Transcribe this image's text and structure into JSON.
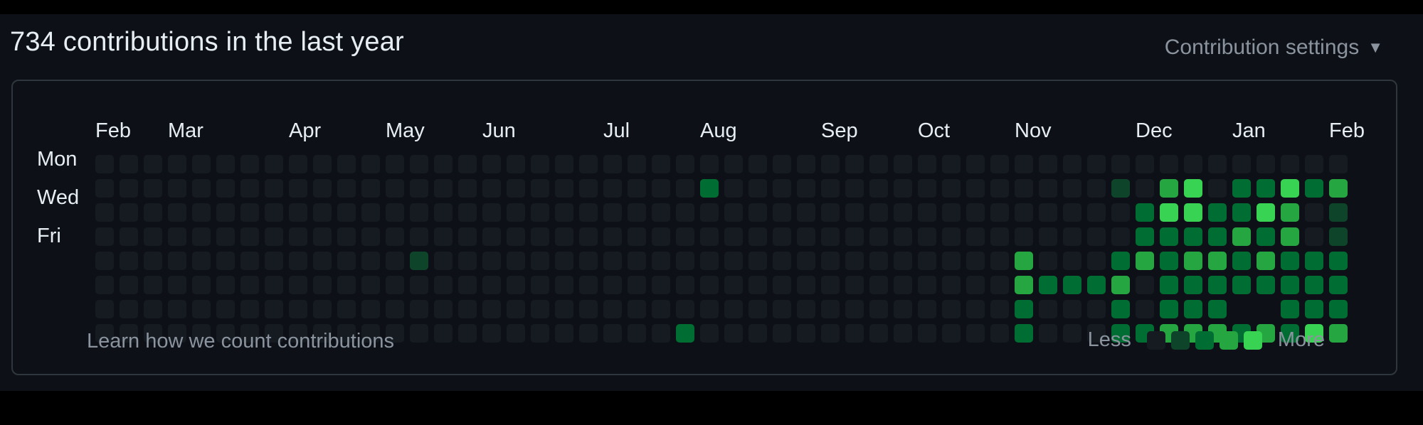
{
  "header": {
    "title": "734 contributions in the last year",
    "settings_label": "Contribution settings"
  },
  "graph": {
    "months": [
      "Feb",
      "Mar",
      "Apr",
      "May",
      "Jun",
      "Jul",
      "Aug",
      "Sep",
      "Oct",
      "Nov",
      "Dec",
      "Jan",
      "Feb"
    ],
    "month_week_index": [
      0,
      3,
      8,
      12,
      16,
      21,
      25,
      30,
      34,
      38,
      43,
      47,
      51
    ],
    "day_labels": [
      "Mon",
      "Wed",
      "Fri"
    ],
    "levels": [
      "0000000000000000000000000000000000000000000000000000",
      "0000000000000000000000000200000000000000001034022423",
      "0000000000000000000000000000000000000000000244224301",
      "0000000000000000000000000000000000000000000222232301",
      "0000000000000100000000000000000000000030002323323222",
      "0000000000000000000000000000000000000032223022222222",
      "0000000000000000000000000000000000000020002022255222",
      "0000000000000000000000002000000000000020002233323243"
    ]
  },
  "colors": {
    "level0": "#161b22",
    "level1": "#0e4429",
    "level2": "#006d32",
    "level3": "#26a641",
    "level4": "#39d353"
  },
  "footer": {
    "learn_link": "Learn how we count contributions",
    "legend_less": "Less",
    "legend_more": "More"
  }
}
